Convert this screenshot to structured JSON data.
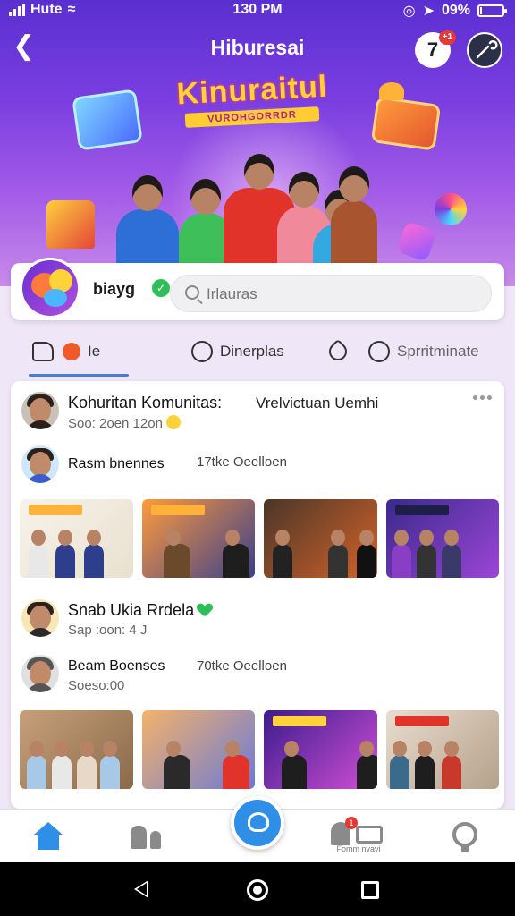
{
  "status_bar": {
    "carrier": "Hute",
    "time": "130 PM",
    "battery": "09%",
    "battery_level": 0.09
  },
  "header": {
    "title": "Hiburesai",
    "notification_count": "1",
    "notification_glyph": "7"
  },
  "banner": {
    "title": "Kinuraitul",
    "subtitle": "VUROHGORRDR"
  },
  "profile": {
    "name": "biayg",
    "search_placeholder": "Irlauras"
  },
  "tabs": [
    {
      "label": "Ie",
      "icon": "like-icon",
      "active": true
    },
    {
      "label": "Dinerplas",
      "icon": "heart-outline-icon"
    },
    {
      "label": "",
      "icon": "location-pin-icon"
    },
    {
      "label": "Sprritminate",
      "icon": "chat-bubble-icon"
    }
  ],
  "feed": {
    "post_title": "Kohuritan Komunitas:",
    "post_title_aside": "Vrelvictuan Uemhi",
    "post_meta": "Soo: 2oen 12on",
    "items": [
      {
        "title": "Rasm bnennes",
        "aside": "17tke Oeelloen"
      },
      {
        "title": "Snab Ukia Rrdela",
        "meta": "Sap :oon: 4 J"
      },
      {
        "title": "Beam Boenses",
        "aside": "70tke Oeelloen",
        "meta": "Soeso:00"
      }
    ]
  },
  "bottom_nav": {
    "caption": "Fomm nvavi",
    "badge": "1"
  },
  "colors": {
    "accent": "#2f8fe6",
    "header_gradient_top": "#5a2fd0",
    "verified": "#2fbf5a",
    "badge": "#e53935"
  }
}
